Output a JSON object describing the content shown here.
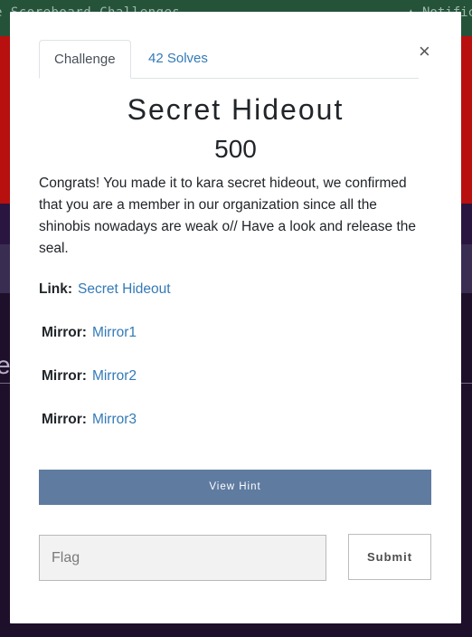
{
  "background": {
    "nav_text": "e  Scoreboard  Challenges",
    "nav_right": "Notific",
    "left_letter": "e"
  },
  "modal": {
    "close_label": "×",
    "tabs": [
      {
        "label": "Challenge",
        "active": true
      },
      {
        "label": "42 Solves",
        "active": false
      }
    ],
    "title": "Secret Hideout",
    "value": "500",
    "description": "Congrats! You made it to kara secret hideout, we confirmed that you are a member in our organization since all the shinobis nowadays are weak o// Have a look and release the seal.",
    "links": [
      {
        "label": "Link:",
        "text": "Secret Hideout"
      },
      {
        "label": "Mirror:",
        "text": "Mirror1"
      },
      {
        "label": "Mirror:",
        "text": "Mirror2"
      },
      {
        "label": "Mirror:",
        "text": "Mirror3"
      }
    ],
    "hint_button": "View Hint",
    "flag_placeholder": "Flag",
    "submit_label": "Submit"
  },
  "colors": {
    "accent_link": "#337ab7",
    "hint_button_bg": "#5f7ba0",
    "banner_red": "#b80f0f",
    "nav_green": "#24533a"
  }
}
